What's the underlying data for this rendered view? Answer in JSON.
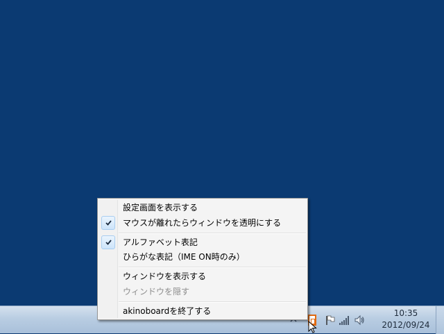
{
  "menu": {
    "items": [
      {
        "label": "設定画面を表示する",
        "checked": false,
        "enabled": true
      },
      {
        "label": "マウスが離れたらウィンドウを透明にする",
        "checked": true,
        "enabled": true
      },
      {
        "label": "アルファベット表記",
        "checked": true,
        "enabled": true
      },
      {
        "label": "ひらがな表記（IME ON時のみ）",
        "checked": false,
        "enabled": true
      },
      {
        "label": "ウィンドウを表示する",
        "checked": false,
        "enabled": true
      },
      {
        "label": "ウィンドウを隠す",
        "checked": false,
        "enabled": false
      },
      {
        "label": "akinoboardを終了する",
        "checked": false,
        "enabled": true
      }
    ]
  },
  "taskbar": {
    "clock": {
      "time": "10:35",
      "date": "2012/09/24"
    },
    "tray_icons": [
      "akinoboard-icon",
      "action-center-flag-icon",
      "network-signal-icon",
      "volume-icon"
    ]
  },
  "colors": {
    "desktop": "#0b3a72",
    "taskbar": "#b9cde2",
    "menu_background": "#f4f4f4",
    "disabled_text": "#8d8d8d",
    "tray_app_accent": "#e06a12"
  }
}
